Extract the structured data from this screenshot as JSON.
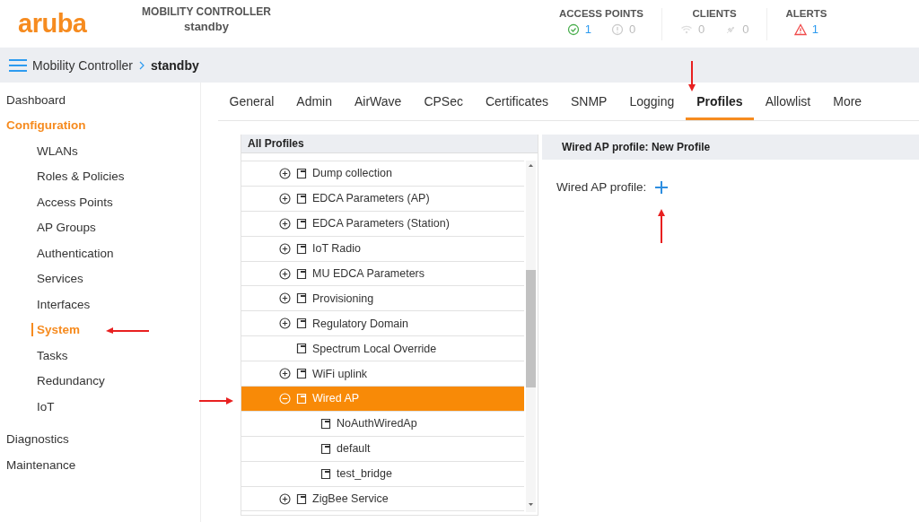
{
  "header": {
    "logo": "aruba",
    "controller_label": "MOBILITY CONTROLLER",
    "controller_name": "standby",
    "stats": [
      {
        "title": "ACCESS POINTS",
        "items": [
          {
            "kind": "ok",
            "value": "1"
          },
          {
            "kind": "warning",
            "value": "0"
          }
        ]
      },
      {
        "title": "CLIENTS",
        "items": [
          {
            "kind": "wireless",
            "value": "0"
          },
          {
            "kind": "wired",
            "value": "0"
          }
        ]
      },
      {
        "title": "ALERTS",
        "items": [
          {
            "kind": "alert",
            "value": "1"
          }
        ]
      }
    ]
  },
  "breadcrumb": [
    "Mobility Controller",
    "standby"
  ],
  "sidebar": {
    "items": [
      {
        "label": "Dashboard",
        "selected": false
      },
      {
        "label": "Configuration",
        "selected": true,
        "children": [
          {
            "label": "WLANs",
            "selected": false
          },
          {
            "label": "Roles & Policies",
            "selected": false
          },
          {
            "label": "Access Points",
            "selected": false
          },
          {
            "label": "AP Groups",
            "selected": false
          },
          {
            "label": "Authentication",
            "selected": false
          },
          {
            "label": "Services",
            "selected": false
          },
          {
            "label": "Interfaces",
            "selected": false
          },
          {
            "label": "System",
            "selected": true
          },
          {
            "label": "Tasks",
            "selected": false
          },
          {
            "label": "Redundancy",
            "selected": false
          },
          {
            "label": "IoT",
            "selected": false
          }
        ]
      },
      {
        "label": "Diagnostics",
        "selected": false
      },
      {
        "label": "Maintenance",
        "selected": false
      }
    ]
  },
  "tabs": [
    {
      "label": "General",
      "selected": false
    },
    {
      "label": "Admin",
      "selected": false
    },
    {
      "label": "AirWave",
      "selected": false
    },
    {
      "label": "CPSec",
      "selected": false
    },
    {
      "label": "Certificates",
      "selected": false
    },
    {
      "label": "SNMP",
      "selected": false
    },
    {
      "label": "Logging",
      "selected": false
    },
    {
      "label": "Profiles",
      "selected": true
    },
    {
      "label": "Allowlist",
      "selected": false
    },
    {
      "label": "More",
      "selected": false
    }
  ],
  "profiles_panel": {
    "title": "All Profiles",
    "items": [
      {
        "label": "Dump collection",
        "kind": "group",
        "expanded": false,
        "selected": false
      },
      {
        "label": "EDCA Parameters (AP)",
        "kind": "group",
        "expanded": false,
        "selected": false
      },
      {
        "label": "EDCA Parameters (Station)",
        "kind": "group",
        "expanded": false,
        "selected": false
      },
      {
        "label": "IoT Radio",
        "kind": "group",
        "expanded": false,
        "selected": false
      },
      {
        "label": "MU EDCA Parameters",
        "kind": "group",
        "expanded": false,
        "selected": false
      },
      {
        "label": "Provisioning",
        "kind": "group",
        "expanded": false,
        "selected": false
      },
      {
        "label": "Regulatory Domain",
        "kind": "group",
        "expanded": false,
        "selected": false
      },
      {
        "label": "Spectrum Local Override",
        "kind": "leaf",
        "selected": false
      },
      {
        "label": "WiFi uplink",
        "kind": "group",
        "expanded": false,
        "selected": false
      },
      {
        "label": "Wired AP",
        "kind": "group",
        "expanded": true,
        "selected": true,
        "children": [
          {
            "label": "NoAuthWiredAp",
            "kind": "leaf",
            "selected": false
          },
          {
            "label": "default",
            "kind": "leaf",
            "selected": false
          },
          {
            "label": "test_bridge",
            "kind": "leaf",
            "selected": false
          }
        ]
      },
      {
        "label": "ZigBee Service",
        "kind": "group",
        "expanded": false,
        "selected": false
      }
    ]
  },
  "detail_panel": {
    "title": "Wired AP profile: New Profile",
    "field_label": "Wired AP profile:"
  }
}
